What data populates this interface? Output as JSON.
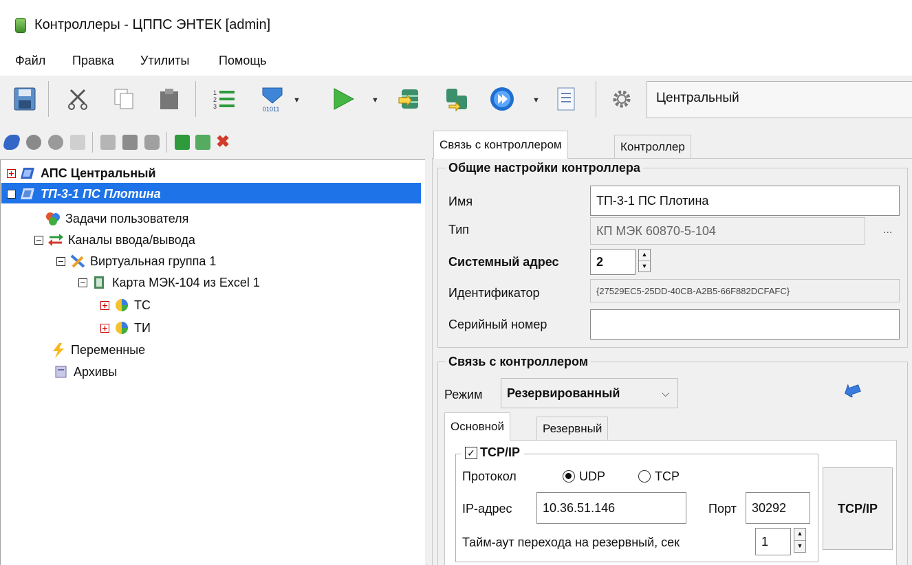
{
  "window": {
    "title": "Контроллеры - ЦППС ЭНТЕК [admin]"
  },
  "menu": [
    "Файл",
    "Правка",
    "Утилиты",
    "Помощь"
  ],
  "toolbar": {
    "icons": [
      "save-icon",
      "cut-icon",
      "copy-icon",
      "paste-icon",
      "numbered-list-icon",
      "download-binary-icon",
      "run-icon",
      "database-icon",
      "sync-icon",
      "play-circle-icon",
      "document-icon",
      "settings-icon"
    ],
    "context_value": "Центральный"
  },
  "tree": {
    "nodes": [
      {
        "label": "АПС Центральный",
        "bold": true
      },
      {
        "label": "ТП-3-1 ПС Плотина",
        "selected": true
      },
      {
        "label": "Задачи пользователя"
      },
      {
        "label": "Каналы ввода/вывода"
      },
      {
        "label": "Виртуальная группа 1"
      },
      {
        "label": "Карта МЭК-104 из Excel 1"
      },
      {
        "label": "ТС"
      },
      {
        "label": "ТИ"
      },
      {
        "label": "Переменные"
      },
      {
        "label": "Архивы"
      }
    ]
  },
  "tabs": {
    "connection": "Связь с контроллером",
    "controller": "Контроллер"
  },
  "general": {
    "title": "Общие настройки контроллера",
    "name_label": "Имя",
    "name_value": "ТП-3-1 ПС Плотина",
    "type_label": "Тип",
    "type_value": "КП МЭК 60870-5-104",
    "type_more": "...",
    "sysaddr_label": "Системный адрес",
    "sysaddr_value": "2",
    "id_label": "Идентификатор",
    "id_value": "{27529EC5-25DD-40CB-A2B5-66F882DCFAFC}",
    "serial_label": "Серийный номер",
    "serial_value": ""
  },
  "connection": {
    "title": "Связь с контроллером",
    "mode_label": "Режим",
    "mode_value": "Резервированный",
    "tab_main": "Основной",
    "tab_reserve": "Резервный",
    "tcpip_label": "TCP/IP",
    "tcpip_checked": true,
    "protocol_label": "Протокол",
    "udp_label": "UDP",
    "tcp_label": "TCP",
    "protocol_selected": "UDP",
    "ip_label": "IP-адрес",
    "ip_value": "10.36.51.146",
    "port_label": "Порт",
    "port_value": "30292",
    "timeout_label": "Тайм-аут перехода на резервный, сек",
    "timeout_value": "1",
    "side_button": "TCP/IP"
  },
  "colors": {
    "selection": "#1e73e8",
    "accent_blue": "#2a6fd6"
  }
}
